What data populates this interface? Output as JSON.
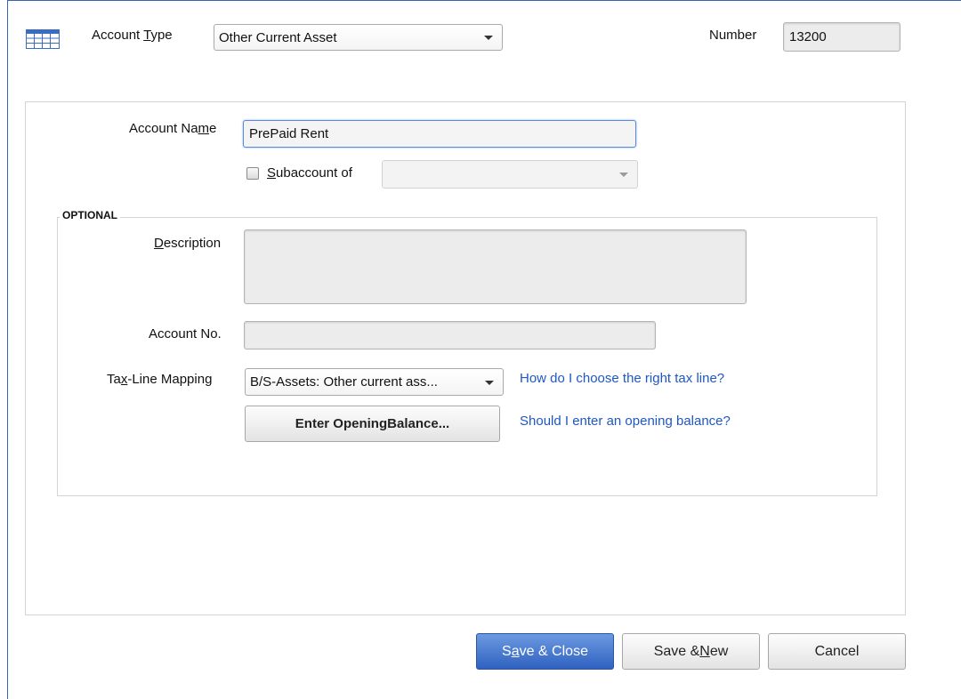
{
  "header": {
    "account_type_label_pre": "Account ",
    "account_type_label_u": "T",
    "account_type_label_post": "ype",
    "account_type_value": "Other Current Asset",
    "number_label": "Number",
    "number_value": "13200"
  },
  "form": {
    "account_name_label_pre": "Account Na",
    "account_name_label_u": "m",
    "account_name_label_post": "e",
    "account_name_value": "PrePaid Rent",
    "subaccount_label_u": "S",
    "subaccount_label_post": "ubaccount of",
    "subaccount_checked": false,
    "subaccount_value": ""
  },
  "optional": {
    "title": "OPTIONAL",
    "description_label_u": "D",
    "description_label_post": "escription",
    "description_value": "",
    "account_no_label": "Account No.",
    "account_no_value": "",
    "tax_line_label_pre": "Ta",
    "tax_line_label_u": "x",
    "tax_line_label_post": "-Line Mapping",
    "tax_line_value": "B/S-Assets: Other current ass...",
    "tax_line_help_link": "How do I choose the right tax line?",
    "opening_balance_pre": "Enter Openin",
    "opening_balance_u": "g",
    "opening_balance_post": " Balance...",
    "opening_balance_help_link": "Should I enter an opening balance?"
  },
  "footer": {
    "save_close_pre": "S",
    "save_close_u": "a",
    "save_close_post": "ve & Close",
    "save_new_pre": "Save & ",
    "save_new_u": "N",
    "save_new_post": "ew",
    "cancel_label": "Cancel"
  },
  "icons": {
    "account_grid": "account-register-grid-icon",
    "dropdown": "chevron-down-icon"
  },
  "colors": {
    "primary_button": "#2f62c1",
    "link": "#1f57c3",
    "window_border": "#3a63b0"
  }
}
